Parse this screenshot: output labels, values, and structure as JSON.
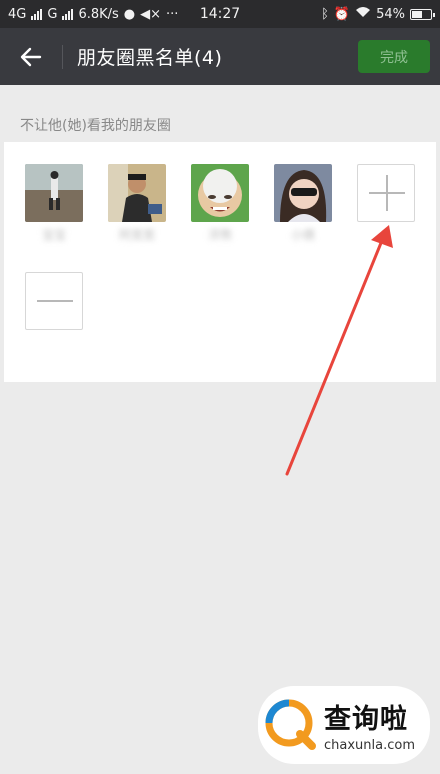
{
  "status_bar": {
    "network1": "4G",
    "network2": "G",
    "speed": "6.8K/s",
    "time": "14:27",
    "battery": "54%",
    "battery_level": 0.54
  },
  "header": {
    "back_icon": "arrow-left-icon",
    "title": "朋友圈黑名单(4)",
    "done_label": "完成"
  },
  "section": {
    "label": "不让他(她)看我的朋友圈"
  },
  "members": [
    {
      "name": "宝宝",
      "avatar": "beach-photo"
    },
    {
      "name": "阿宽宽",
      "avatar": "man-in-jacket-photo"
    },
    {
      "name": "浮熬",
      "avatar": "laughing-face-photo"
    },
    {
      "name": "小倩",
      "avatar": "girl-with-sunglasses-photo"
    }
  ],
  "actions": {
    "add_icon": "plus-icon",
    "remove_icon": "minus-icon"
  },
  "annotation": {
    "arrow_color": "#e8453c"
  },
  "watermark": {
    "text": "查询啦",
    "url": "chaxunla.com"
  }
}
